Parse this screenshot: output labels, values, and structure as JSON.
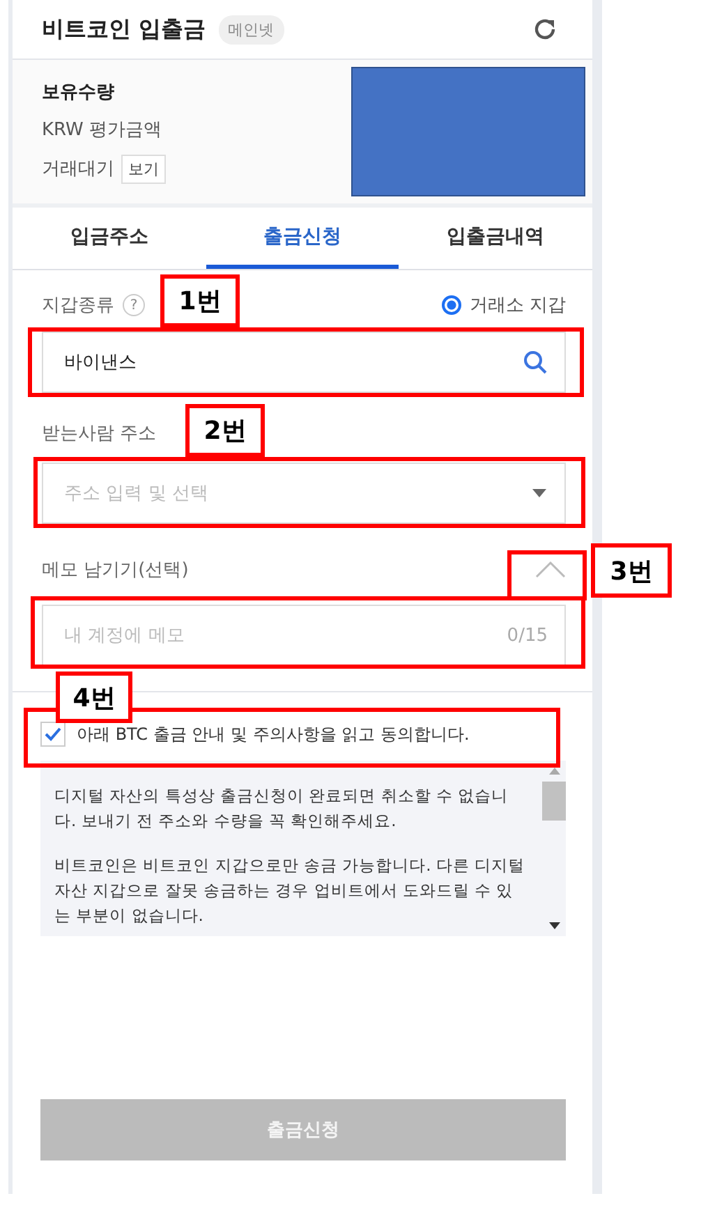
{
  "header": {
    "title": "비트코인 입출금",
    "badge": "메인넷"
  },
  "summary": {
    "rows": [
      {
        "kind": "strong",
        "label": "보유수량"
      },
      {
        "kind": "plain",
        "label": "KRW 평가금액"
      },
      {
        "kind": "button",
        "label": "거래대기",
        "button": "보기"
      }
    ]
  },
  "tabs": [
    {
      "label": "입금주소",
      "selected": false
    },
    {
      "label": "출금신청",
      "selected": true
    },
    {
      "label": "입출금내역",
      "selected": false
    }
  ],
  "wallet": {
    "label": "지갑종류",
    "help": "?",
    "radio": {
      "label": "거래소 지갑",
      "selected": true
    },
    "value": "바이낸스"
  },
  "recipient": {
    "label": "받는사람 주소",
    "placeholder": "주소 입력 및 선택"
  },
  "memo": {
    "label": "메모 남기기(선택)",
    "expanded": true,
    "placeholder": "내 계정에 메모",
    "counter": "0/15"
  },
  "agree": {
    "label": "아래 BTC 출금 안내 및 주의사항을 읽고 동의합니다.",
    "checked": true
  },
  "notice": [
    "디지털 자산의 특성상 출금신청이 완료되면 취소할 수 없습니다. 보내기 전 주소와 수량을 꼭 확인해주세요.",
    "비트코인은 비트코인 지갑으로만 송금 가능합니다. 다른 디지털 자산 지갑으로 잘못 송금하는 경우 업비트에서 도와드릴 수 있는 부분이 없습니다."
  ],
  "submit": {
    "label": "출금신청",
    "disabled": true
  },
  "annotations": [
    {
      "kind": "tagged",
      "label": "1번"
    },
    {
      "kind": "tagged",
      "label": "2번"
    },
    {
      "kind": "tagged",
      "label": "3번"
    },
    {
      "kind": "box"
    },
    {
      "kind": "tagged",
      "label": "4번"
    }
  ]
}
